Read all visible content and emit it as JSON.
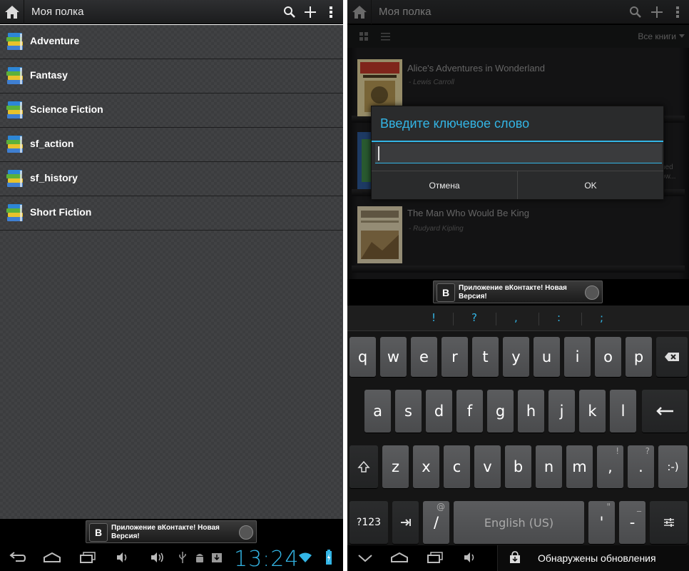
{
  "left": {
    "title": "Моя полка",
    "shelves": [
      {
        "label": "Adventure"
      },
      {
        "label": "Fantasy"
      },
      {
        "label": "Science Fiction"
      },
      {
        "label": "sf_action"
      },
      {
        "label": "sf_history"
      },
      {
        "label": "Short Fiction"
      }
    ],
    "ad": {
      "text": "Приложение вКонтакте! Новая Версия!",
      "logo": "B"
    },
    "clock": "13:24"
  },
  "right": {
    "title": "Моя полка",
    "filter": "Все книги",
    "books": [
      {
        "title": "Alice's Adventures in Wonderland",
        "author": "- Lewis Carroll"
      },
      {
        "title": "The Man Who Would Be King",
        "author": "- Rudyard Kipling"
      }
    ],
    "hidden_fragments": [
      "hed",
      "ow..."
    ],
    "dialog": {
      "title": "Введите ключевое слово",
      "input_value": "",
      "cancel_label": "Отмена",
      "ok_label": "OK"
    },
    "ad": {
      "text": "Приложение вКонтакте! Новая Версия!",
      "logo": "B"
    },
    "keyboard": {
      "suggestions": [
        "!",
        "?",
        ",",
        ":",
        ";"
      ],
      "row1": [
        "q",
        "w",
        "e",
        "r",
        "t",
        "y",
        "u",
        "i",
        "o",
        "p"
      ],
      "row2": [
        "a",
        "s",
        "d",
        "f",
        "g",
        "h",
        "j",
        "k",
        "l"
      ],
      "row3": [
        "z",
        "x",
        "c",
        "v",
        "b",
        "n",
        "m"
      ],
      "comma": ",",
      "comma_alt": "!",
      "period": ".",
      "period_alt": "?",
      "smiley": ":-)",
      "mode_key": "?123",
      "slash": "/",
      "slash_alt": "@",
      "space_label": "English (US)",
      "apostrophe": "'",
      "apostrophe_alt": "\"",
      "dash": "-",
      "dash_alt": "_"
    },
    "notification": "Обнаружены обновления"
  },
  "colors": {
    "accent": "#33b5e5",
    "bar": "#1b1c1d",
    "list_bg": "#3b3c3e"
  }
}
